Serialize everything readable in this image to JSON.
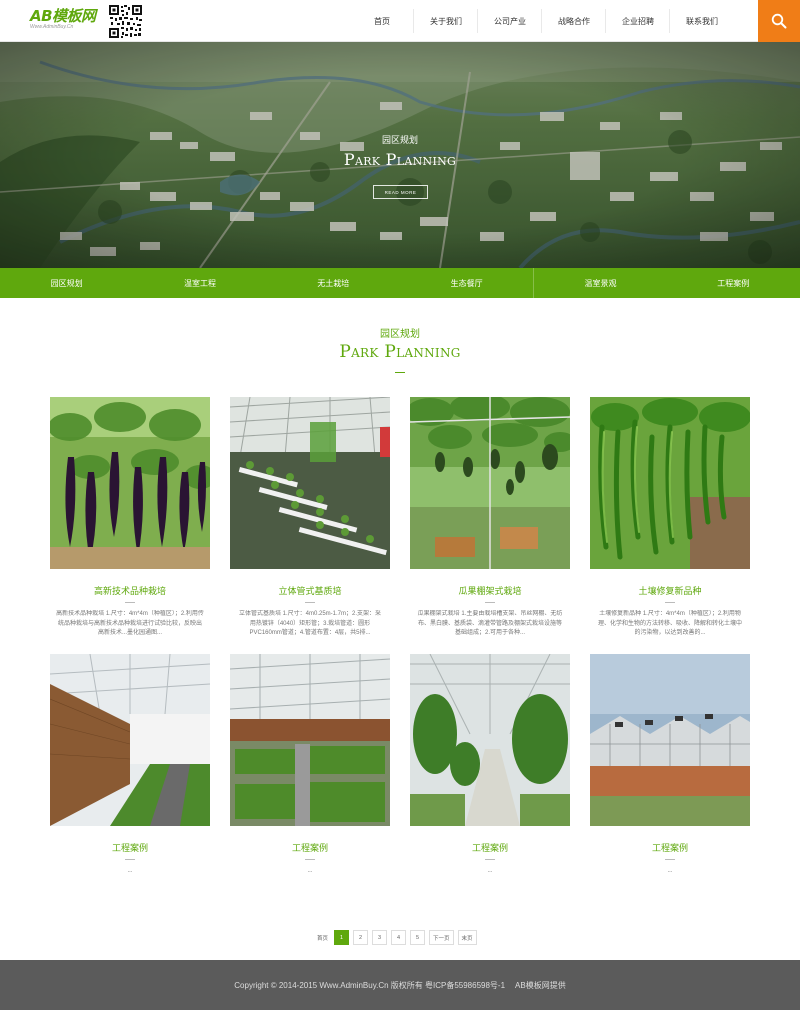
{
  "header": {
    "logo_text": "AB模板网",
    "logo_sub": "Www.AdminBuy.Cn",
    "qr_label": "qr-code",
    "nav": [
      "首页",
      "关于我们",
      "公司产业",
      "战略合作",
      "企业招聘",
      "联系我们"
    ],
    "search_icon": "search-icon",
    "accent": "#f07d17"
  },
  "banner": {
    "subtitle": "园区规划",
    "title": "Park Planning",
    "more": "READ MORE"
  },
  "categories": [
    "园区规划",
    "温室工程",
    "无土栽培",
    "生态餐厅",
    "温室景观",
    "工程案例"
  ],
  "section": {
    "subtitle": "园区规划",
    "title": "Park Planning",
    "accent": "#5fa80d"
  },
  "cards": [
    {
      "title": "高新技术品种栽培",
      "desc": "高新技术品种栽培 1.尺寸：4m*4m（种植区）；2.利用传统品种栽培与高新技术品种栽培进行试验比较，反映出高新技术...墨化园通图..."
    },
    {
      "title": "立体管式基质培",
      "desc": "立体管式基质培 1.尺寸：4m0.25m-1.7m；2.支架：采用热镀锌（4040）矩形管；3.栽培管道：圆形PVC160mm管道；4.管道布置：4层，共5排..."
    },
    {
      "title": "瓜果棚架式栽培",
      "desc": "瓜果棚架式栽培 1.主要由栽培槽支架、吊丝网棚、无纺布、黑白膜、基质袋、滴灌带管路及棚架式栽培设施等基础组成；2.可用于各种..."
    },
    {
      "title": "土壤修复新品种",
      "desc": "土壤修复新品种 1.尺寸：4m*4m（种植区）；2.利用物理、化学和生物的方法转移、吸收、降解和转化土壤中的污染物，以达到改善的..."
    },
    {
      "title": "工程案例",
      "desc": "..."
    },
    {
      "title": "工程案例",
      "desc": "..."
    },
    {
      "title": "工程案例",
      "desc": "..."
    },
    {
      "title": "工程案例",
      "desc": "..."
    }
  ],
  "pagination": [
    "首页",
    "1",
    "2",
    "3",
    "4",
    "5",
    "下一页",
    "末页"
  ],
  "pagination_active": "1",
  "footer": {
    "copyright": "Copyright © 2014-2015 Www.AdminBuy.Cn 版权所有 粤ICP备55986598号-1",
    "provider": "AB模板网提供"
  }
}
